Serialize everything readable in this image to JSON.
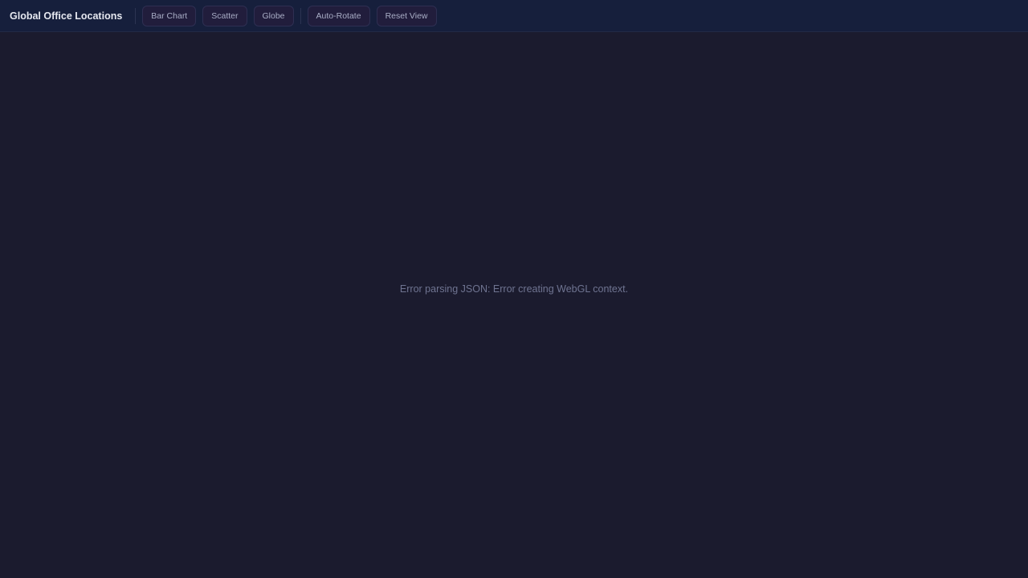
{
  "toolbar": {
    "title": "Global Office Locations",
    "view_buttons": [
      {
        "label": "Bar Chart"
      },
      {
        "label": "Scatter"
      },
      {
        "label": "Globe"
      }
    ],
    "action_buttons": [
      {
        "label": "Auto-Rotate"
      },
      {
        "label": "Reset View"
      }
    ]
  },
  "viewport": {
    "error_message": "Error parsing JSON: Error creating WebGL context."
  },
  "colors": {
    "background": "#1b1b2e",
    "toolbar_bg": "#161f3c",
    "button_bg": "#211d3c",
    "button_text": "#a9aec6",
    "title_text": "#e6e8f0",
    "error_text": "#6f7491"
  }
}
